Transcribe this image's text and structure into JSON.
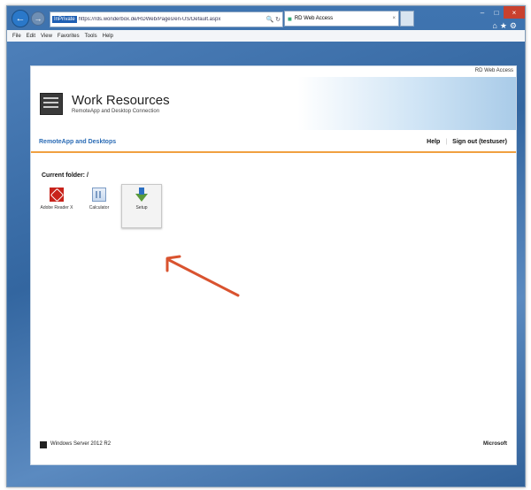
{
  "browser": {
    "inprivate_label": "InPrivate",
    "url": "https://rds.wonderbox.de/RDWeb/Pages/en-US/Default.aspx",
    "tab_title": "RD Web Access",
    "menu": [
      "File",
      "Edit",
      "View",
      "Favorites",
      "Tools",
      "Help"
    ]
  },
  "page": {
    "top_link": "RD Web Access",
    "title": "Work Resources",
    "subtitle": "RemoteApp and Desktop Connection",
    "nav_left": "RemoteApp and Desktops",
    "help": "Help",
    "signout": "Sign out (testuser)",
    "current_folder": "Current folder: /",
    "apps": [
      {
        "label": "Adobe Reader X",
        "icon": "pdf-icon"
      },
      {
        "label": "Calculator",
        "icon": "calculator-icon"
      },
      {
        "label": "Setup",
        "icon": "setup-icon"
      }
    ],
    "footer_left": "Windows Server 2012 R2",
    "footer_right": "Microsoft"
  },
  "colors": {
    "accent": "#2a6bb5",
    "orange": "#f0a040",
    "annotation": "#d9532f"
  }
}
